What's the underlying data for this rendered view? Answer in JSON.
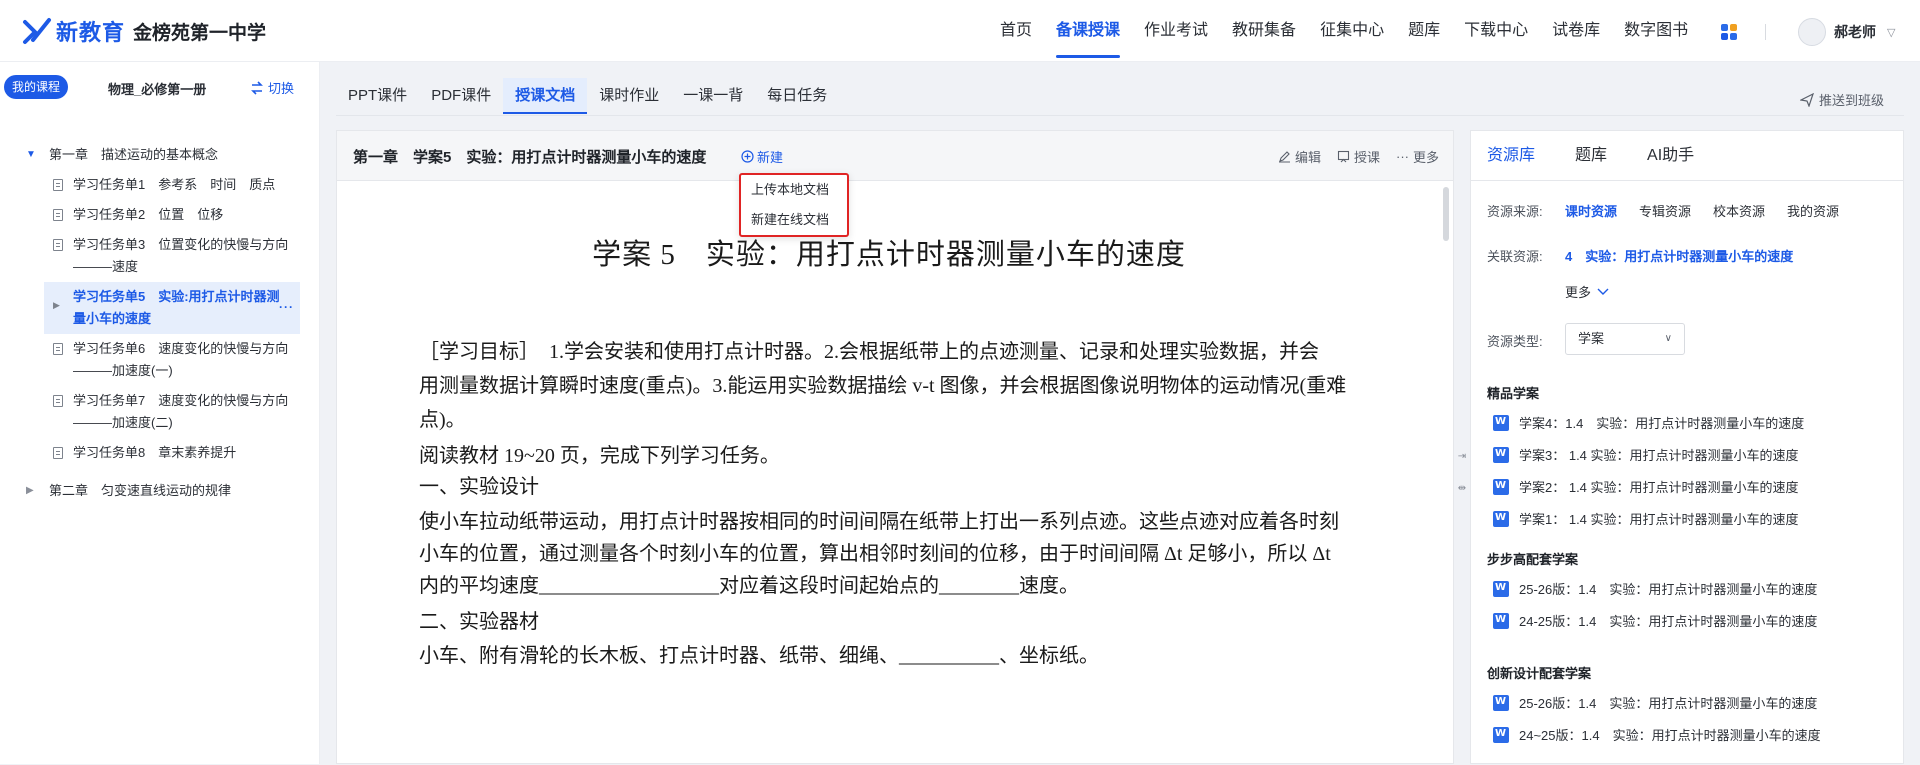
{
  "header": {
    "brand": "新教育",
    "school": "金榜苑第一中学",
    "nav": [
      "首页",
      "备课授课",
      "作业考试",
      "教研集备",
      "征集中心",
      "题库",
      "下载中心",
      "试卷库",
      "数字图书"
    ],
    "active_nav_index": 1,
    "user_name": "郝老师",
    "colors": {
      "accent": "#1d5ae6"
    }
  },
  "sidebar": {
    "course_badge": "我的课程",
    "book_title": "物理_必修第一册",
    "switch_label": "切换",
    "chapter1": "第一章　描述运动的基本概念",
    "tasks": [
      {
        "label": "学习任务单1　参考系　时间　质点"
      },
      {
        "label": "学习任务单2　位置　位移"
      },
      {
        "label": "学习任务单3　位置变化的快慢与方向———速度"
      },
      {
        "label": "学习任务单5　实验:用打点计时器测量小车的速度"
      },
      {
        "label": "学习任务单6　速度变化的快慢与方向———加速度(一)"
      },
      {
        "label": "学习任务单7　速度变化的快慢与方向———加速度(二)"
      },
      {
        "label": "学习任务单8　章末素养提升"
      }
    ],
    "chapter2": "第二章　匀变速直线运动的规律"
  },
  "tabs": {
    "items": [
      "PPT课件",
      "PDF课件",
      "授课文档",
      "课时作业",
      "一课一背",
      "每日任务"
    ],
    "active_index": 2,
    "push_label": "推送到班级"
  },
  "document": {
    "title": "第一章　学案5　实验：用打点计时器测量小车的速度",
    "new_label": "新建",
    "actions": {
      "edit": "编辑",
      "teach": "授课",
      "more": "更多"
    },
    "dropdown": [
      "上传本地文档",
      "新建在线文档"
    ],
    "heading": "学案 5　实验：用打点计时器测量小车的速度",
    "p1_line1": "［学习目标］　1.学会安装和使用打点计时器。2.会根据纸带上的点迹测量、记录和处理实验数据，并会",
    "p1_line2": "用测量数据计算瞬时速度(重点)。3.能运用实验数据描绘 v-t 图像，并会根据图像说明物体的运动情况(重难",
    "p1_line3": "点)。",
    "p2": "阅读教材 19~20 页，完成下列学习任务。",
    "s1": "一、实验设计",
    "p3_line1": "使小车拉动纸带运动，用打点计时器按相同的时间间隔在纸带上打出一系列点迹。这些点迹对应着各时刻",
    "p3_line2": "小车的位置，通过测量各个时刻小车的位置，算出相邻时刻间的位移，由于时间间隔 Δt 足够小，所以 Δt",
    "p3_line3": "内的平均速度__________________对应着这段时间起始点的________速度。",
    "s2": "二、实验器材",
    "p4": "小车、附有滑轮的长木板、打点计时器、纸带、细绳、__________、坐标纸。"
  },
  "resources": {
    "tabs": [
      "资源库",
      "题库",
      "AI助手"
    ],
    "active_tab": 0,
    "source_label": "资源来源:",
    "sources": [
      "课时资源",
      "专辑资源",
      "校本资源",
      "我的资源"
    ],
    "related_label": "关联资源:",
    "related_value": "4　实验：用打点计时器测量小车的速度",
    "more_label": "更多",
    "type_label": "资源类型:",
    "type_value": "学案",
    "sections": [
      {
        "title": "精品学案",
        "items": [
          "学案4：1.4　实验：用打点计时器测量小车的速度",
          "学案3： 1.4 实验：用打点计时器测量小车的速度",
          "学案2： 1.4 实验：用打点计时器测量小车的速度",
          "学案1： 1.4 实验：用打点计时器测量小车的速度"
        ]
      },
      {
        "title": "步步高配套学案",
        "items": [
          "25-26版：1.4　实验：用打点计时器测量小车的速度",
          "24-25版：1.4　实验：用打点计时器测量小车的速度"
        ]
      },
      {
        "title": "创新设计配套学案",
        "items": [
          "25-26版：1.4　实验：用打点计时器测量小车的速度",
          "24~25版：1.4　实验：用打点计时器测量小车的速度"
        ]
      }
    ]
  }
}
